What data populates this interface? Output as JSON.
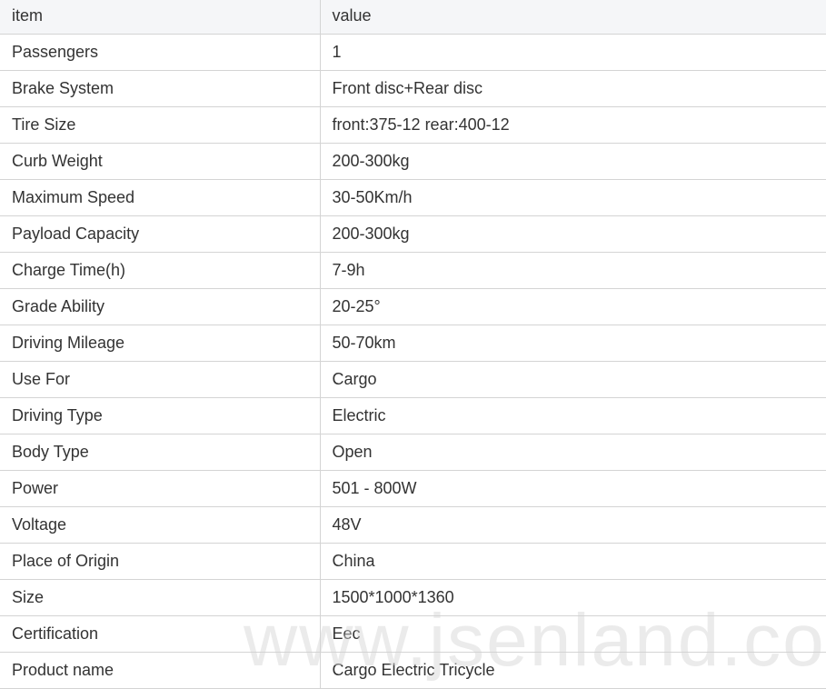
{
  "table": {
    "headers": {
      "item": "item",
      "value": "value"
    },
    "rows": [
      {
        "item": "Passengers",
        "value": "1"
      },
      {
        "item": "Brake System",
        "value": "Front disc+Rear disc"
      },
      {
        "item": "Tire Size",
        "value": "front:375-12 rear:400-12"
      },
      {
        "item": "Curb Weight",
        "value": "200-300kg"
      },
      {
        "item": "Maximum Speed",
        "value": "30-50Km/h"
      },
      {
        "item": "Payload Capacity",
        "value": "200-300kg"
      },
      {
        "item": "Charge Time(h)",
        "value": "7-9h"
      },
      {
        "item": "Grade Ability",
        "value": "20-25°"
      },
      {
        "item": "Driving Mileage",
        "value": "50-70km"
      },
      {
        "item": "Use For",
        "value": "Cargo"
      },
      {
        "item": "Driving Type",
        "value": "Electric"
      },
      {
        "item": "Body Type",
        "value": "Open"
      },
      {
        "item": "Power",
        "value": "501 - 800W"
      },
      {
        "item": "Voltage",
        "value": "48V"
      },
      {
        "item": "Place of Origin",
        "value": "China"
      },
      {
        "item": "Size",
        "value": "1500*1000*1360"
      },
      {
        "item": "Certification",
        "value": "Eec"
      },
      {
        "item": "Product name",
        "value": "Cargo Electric Tricycle"
      }
    ]
  },
  "watermark": {
    "text": "www.jsenland.com"
  },
  "colors": {
    "header_bg": "#f5f6f8",
    "border": "#d4d4d4",
    "text": "#333333"
  }
}
